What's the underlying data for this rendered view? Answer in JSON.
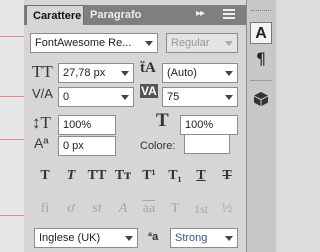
{
  "tabs": {
    "character": "Carattere",
    "paragraph": "Paragrafo",
    "collapse_arrows": "▸▸"
  },
  "font": {
    "family": "FontAwesome Re...",
    "style": "Regular"
  },
  "size": {
    "font_size": "27,78 px",
    "leading": "(Auto)"
  },
  "spacing": {
    "kerning": "0",
    "tracking": "75"
  },
  "scale": {
    "vertical": "100%",
    "horizontal": "100%"
  },
  "baseline": {
    "shift": "0 px",
    "color_label": "Colore:",
    "color_value": "#ffffff"
  },
  "style_buttons": [
    {
      "label": "T",
      "name": "faux-bold"
    },
    {
      "label": "T",
      "name": "faux-italic"
    },
    {
      "label": "TT",
      "name": "all-caps"
    },
    {
      "label": "Tт",
      "name": "small-caps"
    },
    {
      "label": "T¹",
      "name": "superscript"
    },
    {
      "label": "T₁",
      "name": "subscript"
    },
    {
      "label": "T",
      "name": "underline"
    },
    {
      "label": "T",
      "name": "strikethrough"
    }
  ],
  "opentype_buttons": [
    {
      "label": "fi",
      "name": "standard-ligatures"
    },
    {
      "label": "ơ",
      "name": "contextual-alternates"
    },
    {
      "label": "st",
      "name": "discretionary-ligatures"
    },
    {
      "label": "A",
      "name": "swash"
    },
    {
      "label": "aa",
      "name": "stylistic-alternates"
    },
    {
      "label": "T",
      "name": "titling-alternates"
    },
    {
      "label": "1st",
      "name": "ordinals"
    },
    {
      "label": "½",
      "name": "fractions"
    }
  ],
  "footer": {
    "language": "Inglese (UK)",
    "aa_label": "ªa",
    "antialias": "Strong"
  },
  "toolstrip": {
    "character_icon": "A",
    "paragraph_icon": "¶",
    "icon_3d": "cube-icon"
  }
}
